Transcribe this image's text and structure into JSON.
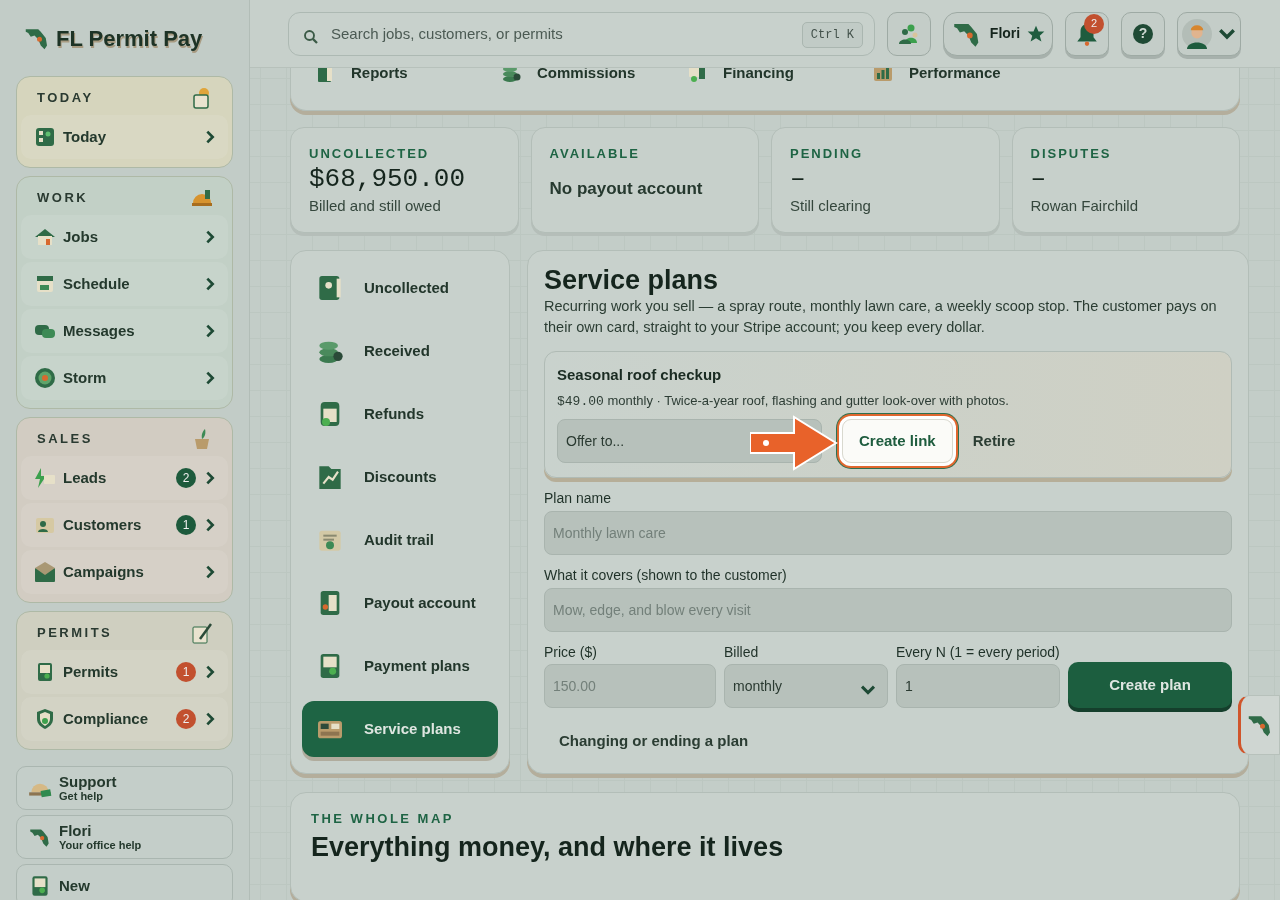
{
  "brand": {
    "name": "FL Permit Pay"
  },
  "search": {
    "placeholder": "Search jobs, customers, or permits",
    "shortcut": "Ctrl K"
  },
  "header": {
    "assistant": {
      "name": "Flori"
    },
    "notifications": {
      "count": "2"
    },
    "help_symbol": "?"
  },
  "sidebar": {
    "groups": [
      {
        "title": "TODAY",
        "color": "#d6d5bd",
        "items": [
          {
            "label": "Today"
          }
        ]
      },
      {
        "title": "WORK",
        "color": "#c2d0c6",
        "items": [
          {
            "label": "Jobs"
          },
          {
            "label": "Schedule"
          },
          {
            "label": "Messages"
          },
          {
            "label": "Storm"
          }
        ]
      },
      {
        "title": "SALES",
        "color": "#d2ccc2",
        "items": [
          {
            "label": "Leads",
            "badge": {
              "text": "2",
              "color": "#1d5a3c"
            }
          },
          {
            "label": "Customers",
            "badge": {
              "text": "1",
              "color": "#1d5a3c"
            }
          },
          {
            "label": "Campaigns"
          }
        ]
      },
      {
        "title": "PERMITS",
        "color": "#cfcfc0",
        "items": [
          {
            "label": "Permits",
            "badge": {
              "text": "1",
              "color": "#c2502f"
            }
          },
          {
            "label": "Compliance",
            "badge": {
              "text": "2",
              "color": "#c2502f"
            }
          }
        ]
      }
    ],
    "footer_links": [
      {
        "title": "Support",
        "subtitle": "Get help"
      },
      {
        "title": "Flori",
        "subtitle": "Your office help"
      },
      {
        "title": "New"
      }
    ]
  },
  "top_nav": [
    {
      "label": "Reports"
    },
    {
      "label": "Commissions"
    },
    {
      "label": "Financing"
    },
    {
      "label": "Performance"
    }
  ],
  "stats": [
    {
      "label": "UNCOLLECTED",
      "kind": "amount",
      "value": "$68,950.00",
      "note": "Billed and still owed"
    },
    {
      "label": "AVAILABLE",
      "kind": "text",
      "value": "No payout account"
    },
    {
      "label": "PENDING",
      "kind": "amount",
      "value": "–",
      "note": "Still clearing"
    },
    {
      "label": "DISPUTES",
      "kind": "amount",
      "value": "–",
      "note": "Rowan Fairchild"
    }
  ],
  "section_nav": [
    {
      "label": "Uncollected",
      "selected": false
    },
    {
      "label": "Received",
      "selected": false
    },
    {
      "label": "Refunds",
      "selected": false
    },
    {
      "label": "Discounts",
      "selected": false
    },
    {
      "label": "Audit trail",
      "selected": false
    },
    {
      "label": "Payout account",
      "selected": false
    },
    {
      "label": "Payment plans",
      "selected": false
    },
    {
      "label": "Service plans",
      "selected": true
    }
  ],
  "service_plans": {
    "title": "Service plans",
    "intro": "Recurring work you sell — a spray route, monthly lawn care, a weekly scoop stop. The customer pays on their own card, straight to your Stripe account; you keep every dollar.",
    "plans": [
      {
        "name": "Seasonal roof checkup",
        "price": "$49.00",
        "details": "monthly · Twice-a-year roof, flashing and gutter look-over with photos.",
        "offer": "Offer to...",
        "create_link": {
          "label": "Create link",
          "highlighted": true
        },
        "retire": "Retire"
      }
    ],
    "form": {
      "name_label": "Plan name",
      "name_placeholder": "Monthly lawn care",
      "covers_label": "What it covers (shown to the customer)",
      "covers_placeholder": "Mow, edge, and blow every visit",
      "price_label": "Price ($)",
      "price_placeholder": "150.00",
      "billed_label": "Billed",
      "billed_value": "monthly",
      "every_label": "Every N (1 = every period)",
      "every_value": "1",
      "submit": "Create plan"
    },
    "help_link": "Changing or ending a plan"
  },
  "map_section": {
    "eyebrow": "THE WHOLE MAP",
    "title": "Everything money, and where it lives"
  }
}
